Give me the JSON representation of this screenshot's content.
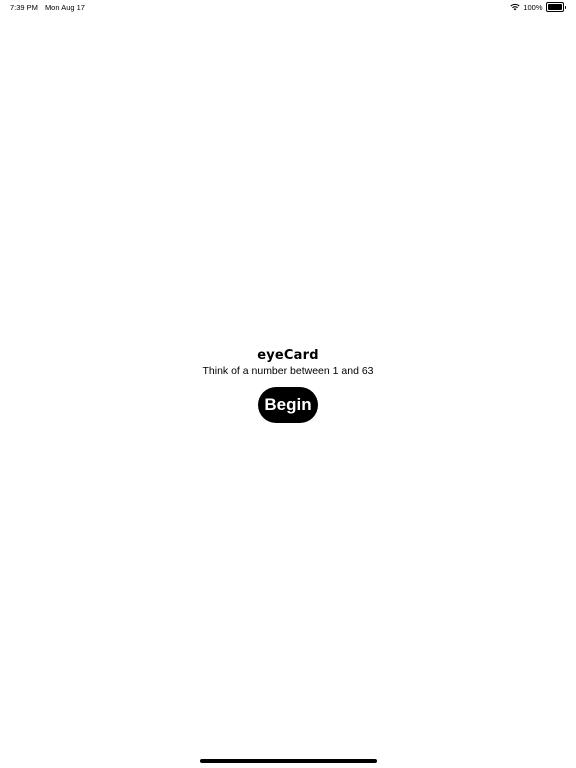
{
  "status_bar": {
    "time": "7:39 PM",
    "date": "Mon Aug 17",
    "battery_percent": "100%",
    "wifi_icon": "wifi-icon",
    "battery_icon": "battery-icon",
    "battery_level": 1.0
  },
  "main": {
    "title": "eyeCard",
    "subtitle": "Think of a number between 1 and 63",
    "begin_label": "Begin"
  },
  "colors": {
    "background": "#ffffff",
    "button_bg": "#000000",
    "button_text": "#ffffff"
  }
}
